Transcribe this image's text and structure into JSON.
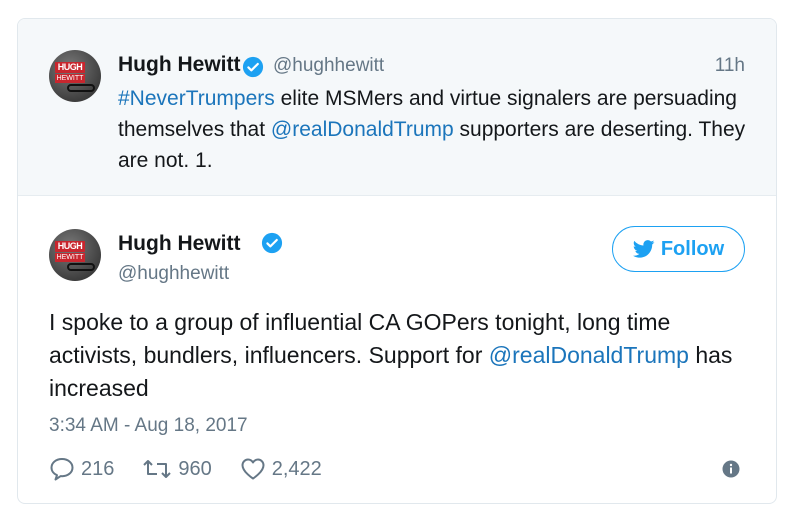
{
  "parent_tweet": {
    "author_name": "Hugh Hewitt",
    "handle": "@hughhewitt",
    "time": "11h",
    "text_parts": {
      "hashtag": "#NeverTrumpers",
      "text1": " elite MSMers and virtue signalers are persuading themselves that ",
      "mention": "@realDonaldTrump",
      "text2": " supporters are deserting. They are not. 1."
    }
  },
  "main_tweet": {
    "author_name": "Hugh Hewitt",
    "handle": "@hughhewitt",
    "follow_label": "Follow",
    "text_parts": {
      "text1": "I spoke to a group of influential CA GOPers tonight, long time activists, bundlers, influencers. Support for ",
      "mention": "@realDonaldTrump",
      "text2": " has increased"
    },
    "timestamp": "3:34 AM - Aug 18, 2017",
    "replies": "216",
    "retweets": "960",
    "likes": "2,422"
  },
  "avatar_logo": {
    "line1": "HUGH",
    "line2": "HEWITT"
  },
  "colors": {
    "link": "#1b75bb",
    "accent": "#1da1f2",
    "muted": "#657786",
    "parent_bg": "#f5f8fa"
  },
  "icons": [
    "verified-icon",
    "twitter-bird-icon",
    "reply-icon",
    "retweet-icon",
    "like-icon",
    "info-icon"
  ]
}
